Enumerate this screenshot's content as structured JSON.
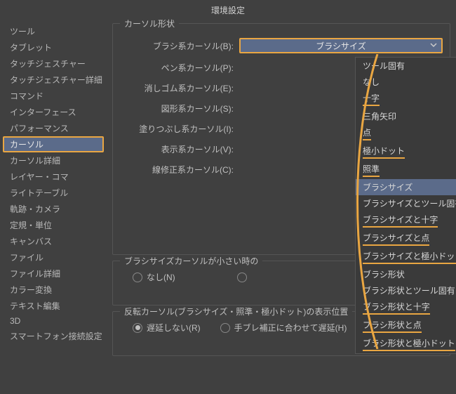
{
  "window_title": "環境設定",
  "sidebar": {
    "items": [
      {
        "label": "ツール"
      },
      {
        "label": "タブレット"
      },
      {
        "label": "タッチジェスチャー"
      },
      {
        "label": "タッチジェスチャー詳細"
      },
      {
        "label": "コマンド"
      },
      {
        "label": "インターフェース"
      },
      {
        "label": "パフォーマンス"
      },
      {
        "label": "カーソル",
        "selected": true
      },
      {
        "label": "カーソル詳細"
      },
      {
        "label": "レイヤー・コマ"
      },
      {
        "label": "ライトテーブル"
      },
      {
        "label": "軌跡・カメラ"
      },
      {
        "label": "定規・単位"
      },
      {
        "label": "キャンバス"
      },
      {
        "label": "ファイル"
      },
      {
        "label": "ファイル詳細"
      },
      {
        "label": "カラー変換"
      },
      {
        "label": "テキスト編集"
      },
      {
        "label": "3D"
      },
      {
        "label": "スマートフォン接続設定"
      }
    ]
  },
  "form": {
    "section1_title": "カーソル形状",
    "rows": [
      {
        "label": "ブラシ系カーソル(B):",
        "value": "ブラシサイズ"
      },
      {
        "label": "ペン系カーソル(P):"
      },
      {
        "label": "消しゴム系カーソル(E):"
      },
      {
        "label": "図形系カーソル(S):"
      },
      {
        "label": "塗りつぶし系カーソル(I):"
      },
      {
        "label": "表示系カーソル(V):"
      },
      {
        "label": "線修正系カーソル(C):"
      }
    ],
    "section2_title": "ブラシサイズカーソルが小さい時の",
    "radio1_a": "なし(N)",
    "section3_title": "反転カーソル(ブラシサイズ・照準・極小ドット)の表示位置",
    "radio2_a": "遅延しない(R)",
    "radio2_b": "手ブレ補正に合わせて遅延(H)"
  },
  "dropdown": {
    "items": [
      {
        "label": "ツール固有"
      },
      {
        "label": "なし"
      },
      {
        "label": "十字",
        "underline": true
      },
      {
        "label": "三角矢印"
      },
      {
        "label": "点",
        "underline": true
      },
      {
        "label": "極小ドット",
        "underline": true
      },
      {
        "label": "照準",
        "underline": true
      },
      {
        "label": "ブラシサイズ",
        "highlight": true
      },
      {
        "label": "ブラシサイズとツール固有"
      },
      {
        "label": "ブラシサイズと十字",
        "underline": true
      },
      {
        "label": "ブラシサイズと点",
        "underline": true
      },
      {
        "label": "ブラシサイズと極小ドット",
        "underline": true
      },
      {
        "label": "ブラシ形状"
      },
      {
        "label": "ブラシ形状とツール固有"
      },
      {
        "label": "ブラシ形状と十字",
        "underline": true
      },
      {
        "label": "ブラシ形状と点",
        "underline": true
      },
      {
        "label": "ブラシ形状と極小ドット",
        "underline": true
      }
    ]
  }
}
